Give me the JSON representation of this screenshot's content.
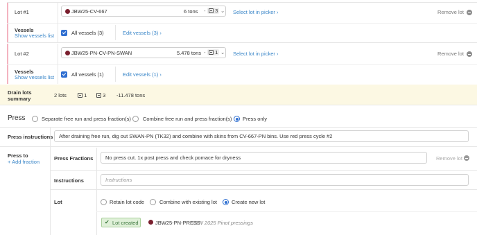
{
  "lots": [
    {
      "label": "Lot #1",
      "code": "JBW25-CV-667",
      "tons": "6 tons",
      "bins": "3",
      "select_link": "Select lot in picker",
      "remove": "Remove lot",
      "vessels_title": "Vessels",
      "vessels_link": "Show vessels list",
      "all_vessels": "All vessels (3)",
      "edit_vessels": "Edit vessels (3)",
      "stripe_color": "#f3b3c0"
    },
    {
      "label": "Lot #2",
      "code": "JBW25-PN-CV-PN-SWAN",
      "tons": "5.478 tons",
      "bins": "1",
      "select_link": "Select lot in picker",
      "remove": "Remove lot",
      "vessels_title": "Vessels",
      "vessels_link": "Show vessels list",
      "all_vessels": "All vessels (1)",
      "edit_vessels": "Edit vessels (1)",
      "stripe_color": "#f3b3c0"
    }
  ],
  "summary": {
    "label_line1": "Drain lots",
    "label_line2": "summary",
    "lots_count": "2 lots",
    "bins_a": "1",
    "bins_b": "3",
    "tons": "-11.478 tons",
    "bg_color": "#fcf8e3"
  },
  "press": {
    "title": "Press",
    "options": [
      "Separate free run and press fraction(s)",
      "Combine free run and press fraction(s)",
      "Press only"
    ],
    "selected": "Press only",
    "instructions_label": "Press instructions",
    "instructions_value": "After draining free run, dig out SWAN-PN (TK32) and combine with skins from CV-667-PN bins. Use red press cycle #2",
    "press_to_label": "Press to",
    "add_fraction": "Add fraction",
    "fractions_label": "Press Fractions",
    "fractions_value": "No press cut. 1x post press and check pomace for dryness",
    "fraction_remove": "Remove lot",
    "instructions2_label": "Instructions",
    "instructions2_placeholder": "Instructions",
    "lot_label": "Lot",
    "lot_options": [
      "Retain lot code",
      "Combine with existing lot",
      "Create new lot"
    ],
    "lot_selected": "Create new lot",
    "lot_created_badge": "Lot created",
    "new_lot_code": "JBW25-PN-PRESS",
    "new_lot_desc": "JBW 2025 Pinot pressings"
  },
  "colors": {
    "accent": "#3a86c8",
    "checkbox": "#2f6fd1",
    "wine_dot": "#7a1f2e",
    "badge_bg": "#dff0d8",
    "badge_border": "#a9cf9b"
  }
}
